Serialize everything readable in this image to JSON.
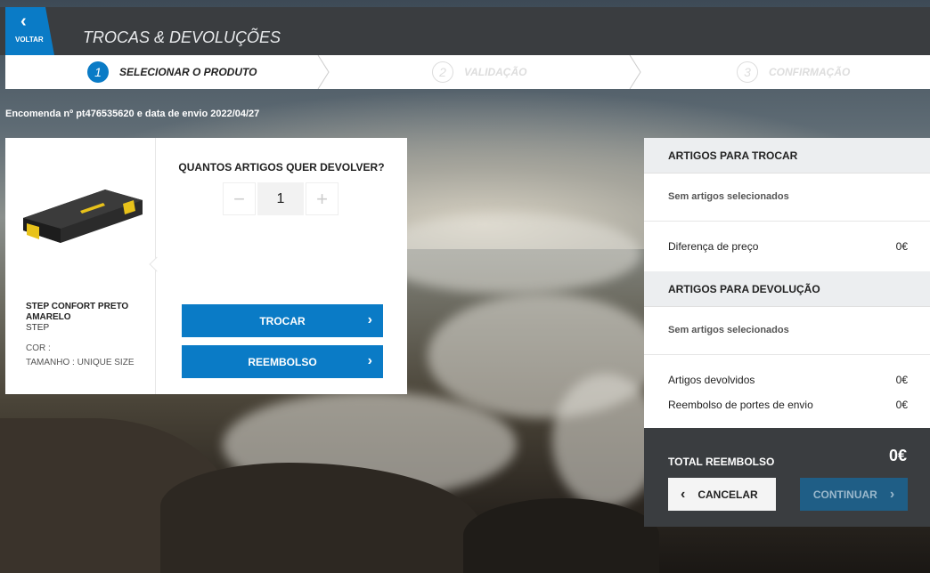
{
  "header": {
    "back_label": "VOLTAR",
    "title": "TROCAS & DEVOLUÇÕES"
  },
  "steps": [
    {
      "number": "1",
      "label": "SELECIONAR O PRODUTO",
      "active": true
    },
    {
      "number": "2",
      "label": "VALIDAÇÃO",
      "active": false
    },
    {
      "number": "3",
      "label": "CONFIRMAÇÃO",
      "active": false
    }
  ],
  "order_info": "Encomenda nº pt476535620 e data de envio 2022/04/27",
  "product": {
    "name": "STEP CONFORT PRETO AMARELO",
    "type": "STEP",
    "color_label": "COR :",
    "size_label": "TAMANHO : UNIQUE SIZE"
  },
  "quantity": {
    "title": "QUANTOS ARTIGOS QUER DEVOLVER?",
    "value": "1",
    "minus": "−",
    "plus": "+"
  },
  "actions": {
    "exchange": "TROCAR",
    "refund": "REEMBOLSO"
  },
  "summary": {
    "exchange_header": "ARTIGOS PARA TROCAR",
    "exchange_empty": "Sem artigos selecionados",
    "price_diff_label": "Diferença de preço",
    "price_diff_value": "0€",
    "return_header": "ARTIGOS PARA DEVOLUÇÃO",
    "return_empty": "Sem artigos selecionados",
    "returned_label": "Artigos devolvidos",
    "returned_value": "0€",
    "shipping_label": "Reembolso de portes de envio",
    "shipping_value": "0€",
    "total_label": "TOTAL REEMBOLSO",
    "total_value": "0€",
    "cancel": "CANCELAR",
    "continue": "CONTINUAR"
  },
  "colors": {
    "accent": "#0a7bc6",
    "dark_panel": "#3a3d40"
  }
}
